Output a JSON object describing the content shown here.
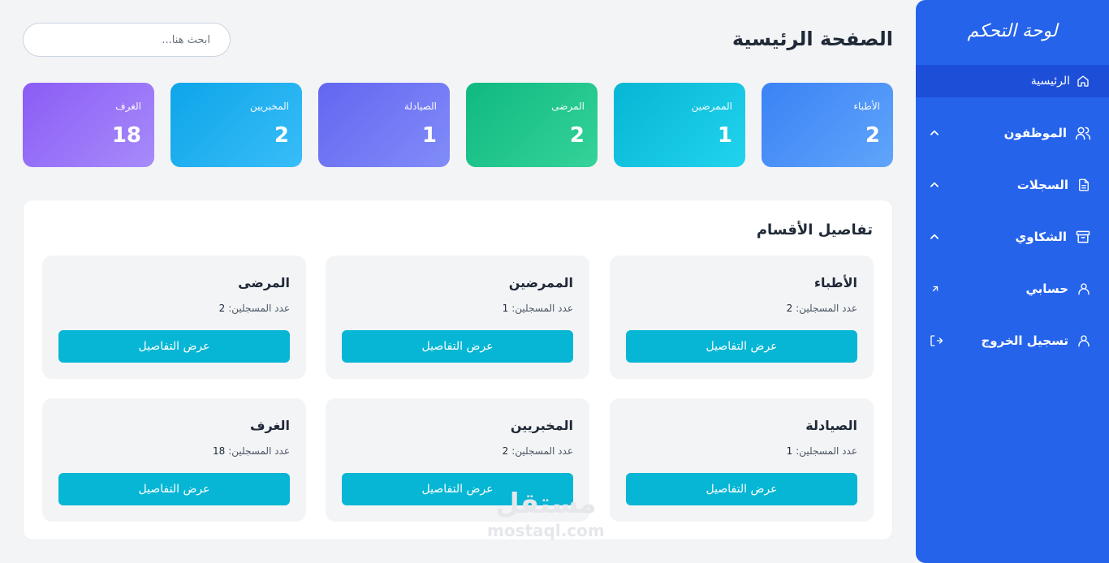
{
  "sidebar": {
    "title": "لوحة التحكم",
    "items": [
      {
        "label": "الرئيسية",
        "icon": "home-icon"
      },
      {
        "label": "الموظفون",
        "icon": "users-icon",
        "trail": "chevron-up-icon"
      },
      {
        "label": "السجلات",
        "icon": "document-icon",
        "trail": "chevron-up-icon"
      },
      {
        "label": "الشكاوي",
        "icon": "archive-icon",
        "trail": "chevron-up-icon"
      },
      {
        "label": "حسابي",
        "icon": "user-icon",
        "trail": "external-link-icon"
      },
      {
        "label": "تسجيل الخروج",
        "icon": "user-icon",
        "trail": "logout-icon"
      }
    ]
  },
  "header": {
    "title": "الصفحة الرئيسية",
    "search_placeholder": "ابحث هنا..."
  },
  "stats": [
    {
      "label": "الأطباء",
      "value": "2",
      "colors": [
        "#3b82f6",
        "#60a5fa"
      ]
    },
    {
      "label": "الممرضين",
      "value": "1",
      "colors": [
        "#06b6d4",
        "#22d3ee"
      ]
    },
    {
      "label": "المرضى",
      "value": "2",
      "colors": [
        "#10b981",
        "#34d399"
      ]
    },
    {
      "label": "الصيادلة",
      "value": "1",
      "colors": [
        "#6366f1",
        "#818cf8"
      ]
    },
    {
      "label": "المخبريين",
      "value": "2",
      "colors": [
        "#0ea5e9",
        "#38bdf8"
      ]
    },
    {
      "label": "الغرف",
      "value": "18",
      "colors": [
        "#8b5cf6",
        "#a78bfa"
      ]
    }
  ],
  "departments": {
    "title": "تفاصيل الأقسام",
    "count_label": "عدد المسجلين:",
    "button_label": "عرض التفاصيل",
    "items": [
      {
        "name": "الأطباء",
        "count": "2"
      },
      {
        "name": "الممرضين",
        "count": "1"
      },
      {
        "name": "المرضى",
        "count": "2"
      },
      {
        "name": "الصيادلة",
        "count": "1"
      },
      {
        "name": "المخبريين",
        "count": "2"
      },
      {
        "name": "الغرف",
        "count": "18"
      }
    ]
  },
  "watermark": {
    "arabic": "مستقل",
    "latin": "mostaql.com"
  },
  "colors": {
    "sidebar": "#2563eb",
    "sidebar_active": "#1d4ed8",
    "button": "#06b6d4",
    "background": "#f3f4f6"
  }
}
